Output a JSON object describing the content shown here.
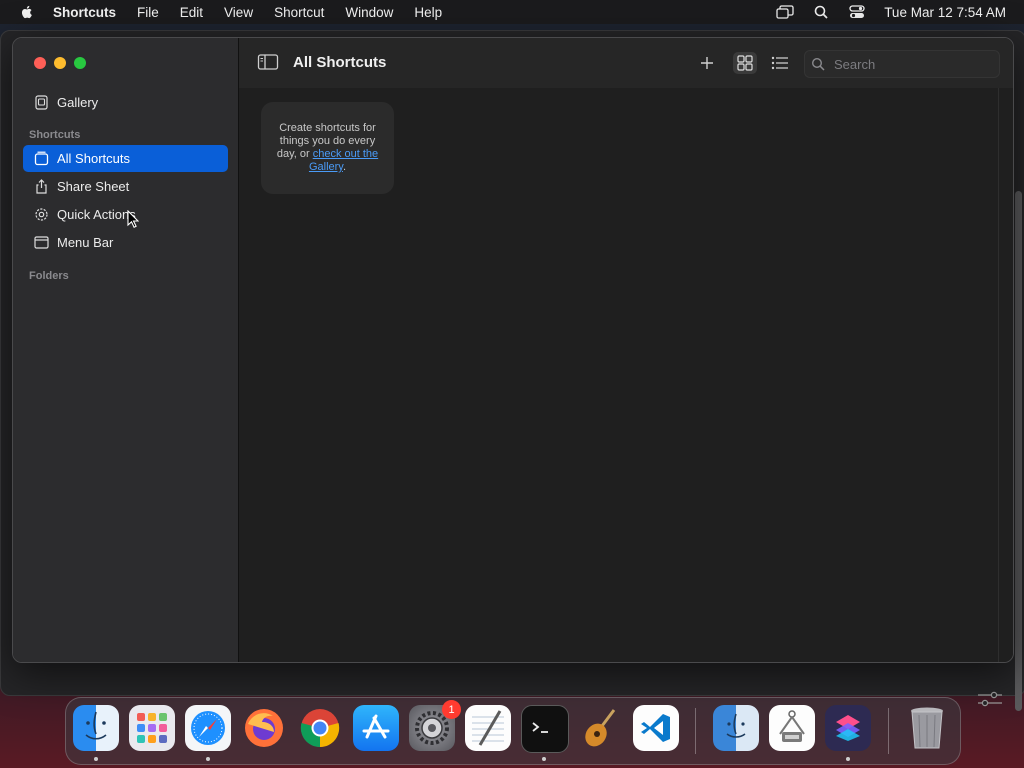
{
  "menubar": {
    "app_name": "Shortcuts",
    "items": [
      "File",
      "Edit",
      "View",
      "Shortcut",
      "Window",
      "Help"
    ],
    "clock": "Tue Mar 12  7:54 AM"
  },
  "sidebar": {
    "gallery_label": "Gallery",
    "shortcuts_section": "Shortcuts",
    "items": [
      {
        "label": "All Shortcuts",
        "icon": "shortcuts-stack-icon",
        "selected": true
      },
      {
        "label": "Share Sheet",
        "icon": "share-icon",
        "selected": false
      },
      {
        "label": "Quick Actions",
        "icon": "gear-icon",
        "selected": false
      },
      {
        "label": "Menu Bar",
        "icon": "menubar-icon",
        "selected": false
      }
    ],
    "folders_section": "Folders"
  },
  "toolbar": {
    "title": "All Shortcuts",
    "search_placeholder": "Search"
  },
  "empty_state": {
    "text": "Create shortcuts for things you do every day, or ",
    "link_text": "check out the Gallery",
    "suffix": "."
  },
  "dock": {
    "apps": [
      "Finder",
      "Launchpad",
      "Safari",
      "Firefox",
      "Chrome",
      "App Store",
      "System Settings",
      "TextEdit",
      "Terminal",
      "GarageBand",
      "Visual Studio Code",
      "Finder",
      "Preview",
      "Shortcuts",
      "Trash"
    ],
    "system_settings_badge": "1"
  },
  "colors": {
    "accent": "#0a5fd8",
    "link": "#4a9bf7",
    "badge": "#ff3b30"
  }
}
